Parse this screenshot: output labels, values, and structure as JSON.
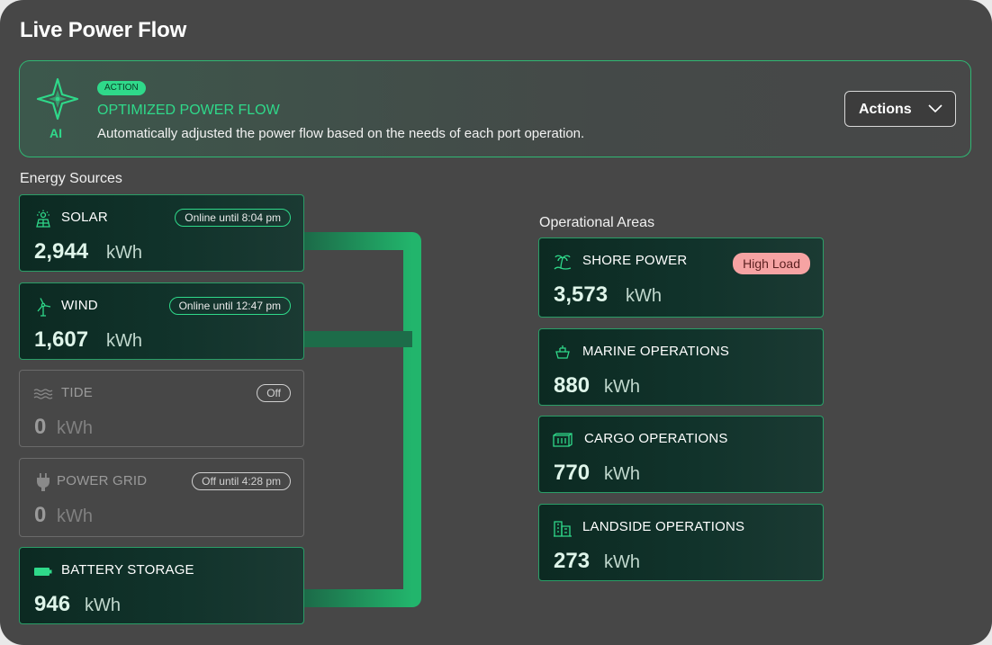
{
  "title": "Live Power Flow",
  "ai": {
    "label": "AI",
    "badge": "ACTION",
    "headline": "OPTIMIZED POWER FLOW",
    "description": "Automatically adjusted the power flow based on the needs of each port operation.",
    "actions_label": "Actions"
  },
  "sources": {
    "label": "Energy Sources",
    "items": [
      {
        "name": "SOLAR",
        "icon": "solar-panel-icon",
        "value": "2,944",
        "unit": "kWh",
        "status": "Online until 8:04 pm",
        "state": "on"
      },
      {
        "name": "WIND",
        "icon": "wind-turbine-icon",
        "value": "1,607",
        "unit": "kWh",
        "status": "Online until 12:47 pm",
        "state": "on"
      },
      {
        "name": "TIDE",
        "icon": "waves-icon",
        "value": "0",
        "unit": "kWh",
        "status": "Off",
        "state": "off"
      },
      {
        "name": "POWER GRID",
        "icon": "plug-icon",
        "value": "0",
        "unit": "kWh",
        "status": "Off until 4:28 pm",
        "state": "off"
      },
      {
        "name": "BATTERY STORAGE",
        "icon": "battery-icon",
        "value": "946",
        "unit": "kWh",
        "status": "",
        "state": "on"
      }
    ]
  },
  "areas": {
    "label": "Operational Areas",
    "items": [
      {
        "name": "SHORE POWER",
        "icon": "palm-island-icon",
        "value": "3,573",
        "unit": "kWh",
        "status": "High Load"
      },
      {
        "name": "MARINE OPERATIONS",
        "icon": "ship-icon",
        "value": "880",
        "unit": "kWh",
        "status": ""
      },
      {
        "name": "CARGO OPERATIONS",
        "icon": "container-icon",
        "value": "770",
        "unit": "kWh",
        "status": ""
      },
      {
        "name": "LANDSIDE OPERATIONS",
        "icon": "buildings-icon",
        "value": "273",
        "unit": "kWh",
        "status": ""
      }
    ]
  },
  "colors": {
    "accent": "#2fd98a",
    "card_border": "#2a9e67",
    "warning": "#f6a3a3",
    "panel": "#474747"
  }
}
